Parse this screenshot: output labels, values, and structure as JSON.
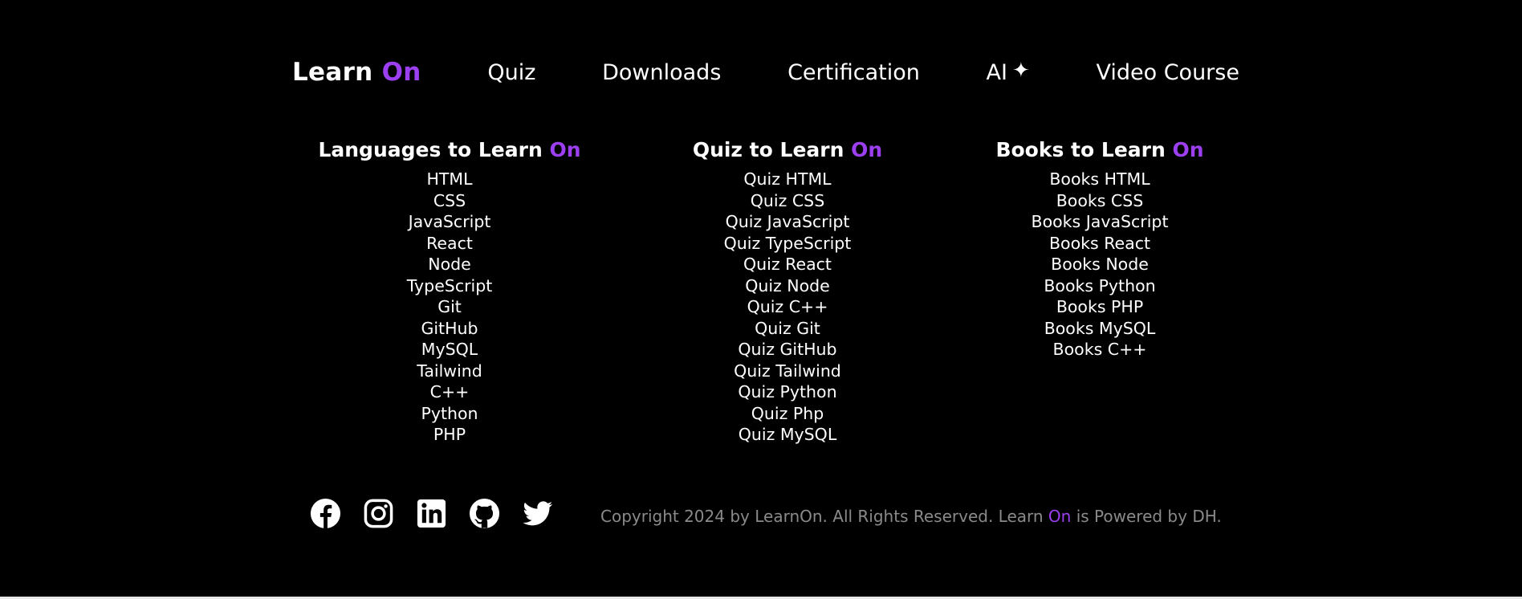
{
  "nav": {
    "brand_main": "Learn",
    "brand_accent": "On",
    "links": [
      {
        "label": "Quiz"
      },
      {
        "label": "Downloads"
      },
      {
        "label": "Certification"
      },
      {
        "label": "AI",
        "suffix": "✦"
      },
      {
        "label": "Video Course"
      }
    ]
  },
  "columns": {
    "languages": {
      "title_main": "Languages to Learn",
      "title_accent": "On",
      "items": [
        "HTML",
        "CSS",
        "JavaScript",
        "React",
        "Node",
        "TypeScript",
        "Git",
        "GitHub",
        "MySQL",
        "Tailwind",
        "C++",
        "Python",
        "PHP"
      ]
    },
    "quiz": {
      "title_main": "Quiz to Learn",
      "title_accent": "On",
      "items": [
        "Quiz HTML",
        "Quiz CSS",
        "Quiz JavaScript",
        "Quiz TypeScript",
        "Quiz React",
        "Quiz Node",
        "Quiz C++",
        "Quiz Git",
        "Quiz GitHub",
        "Quiz Tailwind",
        "Quiz Python",
        "Quiz Php",
        "Quiz MySQL"
      ]
    },
    "books": {
      "title_main": "Books to Learn",
      "title_accent": "On",
      "items": [
        "Books HTML",
        "Books CSS",
        "Books JavaScript",
        "Books React",
        "Books Node",
        "Books Python",
        "Books PHP",
        "Books MySQL",
        "Books C++"
      ]
    }
  },
  "footer": {
    "social_icons": [
      "facebook-icon",
      "instagram-icon",
      "linkedin-icon",
      "github-icon",
      "twitter-icon"
    ],
    "copyright_prefix": "Copyright 2024 by LearnOn. All Rights Reserved. Learn",
    "copyright_accent": "On",
    "copyright_suffix": "is Powered by DH."
  },
  "colors": {
    "background": "#000000",
    "text": "#ffffff",
    "accent": "#9b3ff0",
    "muted": "#8a8a8a"
  }
}
